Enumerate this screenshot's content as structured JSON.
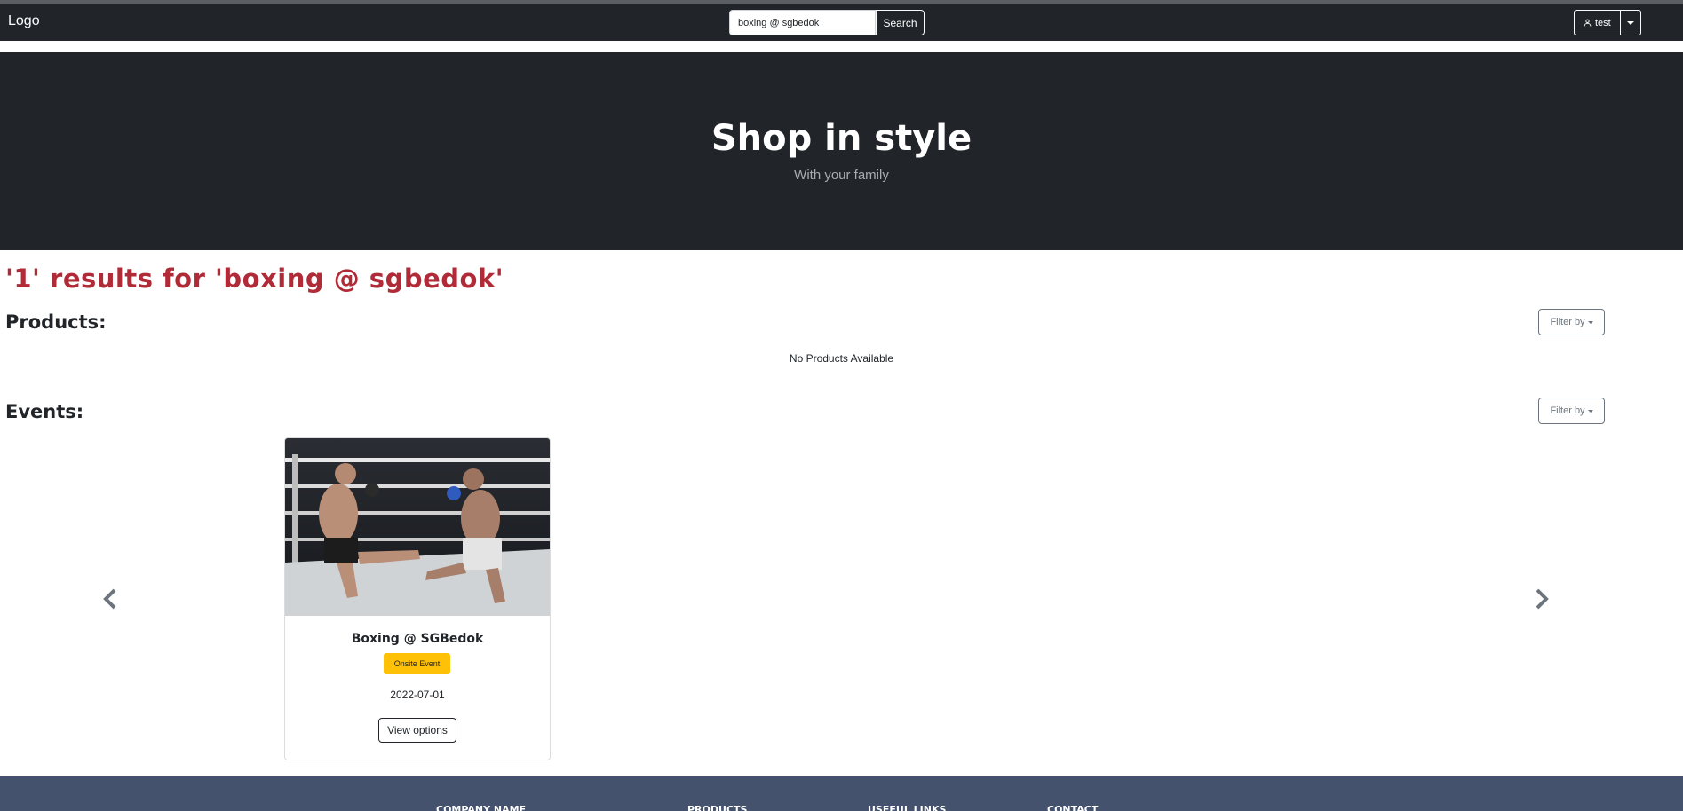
{
  "navbar": {
    "logo": "Logo",
    "search_value": "boxing @ sgbedok",
    "search_button": "Search",
    "user_label": "test",
    "user_icon": "person-icon"
  },
  "hero": {
    "title": "Shop in style",
    "subtitle": "With your family"
  },
  "results_heading": "'1' results for 'boxing @ sgbedok'",
  "products": {
    "heading": "Products:",
    "filter_label": "Filter by",
    "empty_text": "No Products Available"
  },
  "events": {
    "heading": "Events:",
    "filter_label": "Filter by",
    "items": [
      {
        "title": "Boxing @ SGBedok",
        "badge": "Onsite Event",
        "date": "2022-07-01",
        "button": "View options",
        "image": "boxing-match-photo"
      }
    ]
  },
  "footer": {
    "columns": [
      "COMPANY NAME",
      "PRODUCTS",
      "USEFUL LINKS",
      "CONTACT"
    ]
  },
  "colors": {
    "navbar_bg": "#212529",
    "results_red": "#b02a37",
    "badge_yellow": "#ffc107",
    "footer_bg": "#45526e"
  }
}
